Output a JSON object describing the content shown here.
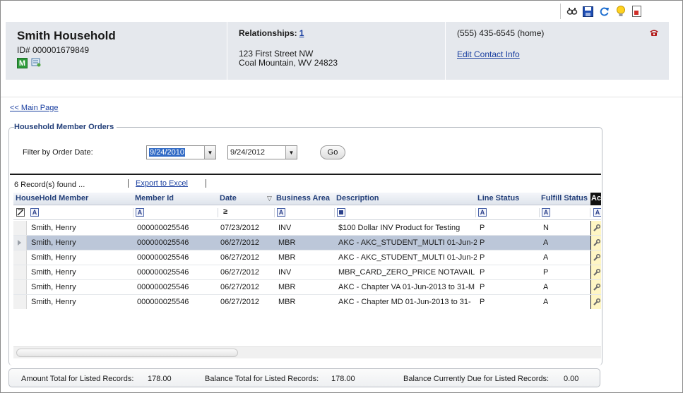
{
  "toolbar": {
    "icons": [
      "view-icon",
      "save-icon",
      "refresh-icon",
      "idea-icon",
      "report-icon"
    ]
  },
  "header": {
    "name": "Smith Household",
    "id_text": "ID# 000001679849",
    "badge": "M",
    "relationships_label": "Relationships:",
    "relationships_count": "1",
    "address_line1": "123 First Street NW",
    "address_line2": "Coal Mountain, WV 24823",
    "phone": "(555) 435-6545 (home)",
    "edit_contact": "Edit Contact Info"
  },
  "nav": {
    "main_page": "<< Main Page"
  },
  "section": {
    "title": "Household Member Orders",
    "filter_label": "Filter by Order Date:",
    "date_from": "9/24/2010",
    "date_to": "9/24/2012",
    "go_label": "Go",
    "record_count": "6 Record(s) found ...",
    "export_label": "Export to Excel"
  },
  "grid": {
    "columns": [
      "HouseHold Member",
      "Member Id",
      "Date",
      "Business Area",
      "Description",
      "Line Status",
      "Fulfill Status",
      "Ac"
    ],
    "rows": [
      {
        "member": "Smith, Henry",
        "member_id": "000000025546",
        "date": "07/23/2012",
        "area": "INV",
        "description": "$100 Dollar INV Product for Testing",
        "line_status": "P",
        "fulfill_status": "N"
      },
      {
        "member": "Smith, Henry",
        "member_id": "000000025546",
        "date": "06/27/2012",
        "area": "MBR",
        "description": "AKC - AKC_STUDENT_MULTI 01-Jun-2",
        "line_status": "P",
        "fulfill_status": "A"
      },
      {
        "member": "Smith, Henry",
        "member_id": "000000025546",
        "date": "06/27/2012",
        "area": "MBR",
        "description": "AKC - AKC_STUDENT_MULTI 01-Jun-2",
        "line_status": "P",
        "fulfill_status": "A"
      },
      {
        "member": "Smith, Henry",
        "member_id": "000000025546",
        "date": "06/27/2012",
        "area": "INV",
        "description": "MBR_CARD_ZERO_PRICE NOTAVAIL",
        "line_status": "P",
        "fulfill_status": "P"
      },
      {
        "member": "Smith, Henry",
        "member_id": "000000025546",
        "date": "06/27/2012",
        "area": "MBR",
        "description": "AKC - Chapter VA 01-Jun-2013 to 31-M",
        "line_status": "P",
        "fulfill_status": "A"
      },
      {
        "member": "Smith, Henry",
        "member_id": "000000025546",
        "date": "06/27/2012",
        "area": "MBR",
        "description": "AKC - Chapter MD 01-Jun-2013 to 31-",
        "line_status": "P",
        "fulfill_status": "A"
      }
    ],
    "selected_row": 1
  },
  "totals": {
    "amount_label": "Amount Total for Listed Records:",
    "amount_value": "178.00",
    "balance_label": "Balance Total for Listed Records:",
    "balance_value": "178.00",
    "due_label": "Balance Currently Due for Listed Records:",
    "due_value": "0.00"
  }
}
